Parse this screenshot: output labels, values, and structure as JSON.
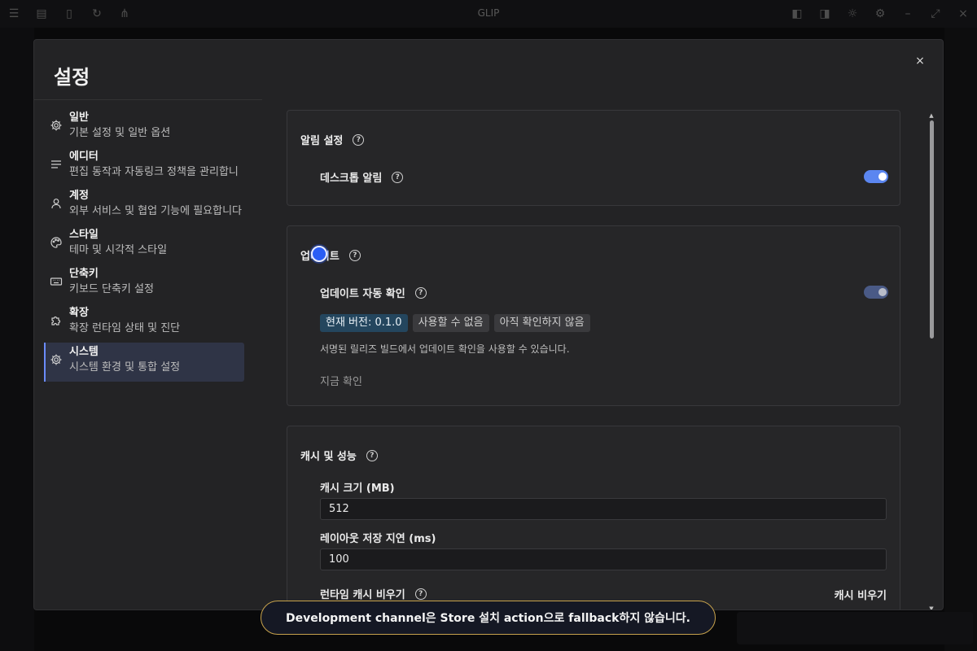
{
  "app": {
    "title": "GLIP"
  },
  "modal": {
    "title": "설정",
    "close": "×"
  },
  "nav": [
    {
      "label": "일반",
      "desc": "기본 설정 및 일반 옵션",
      "icon": "gear-icon"
    },
    {
      "label": "에디터",
      "desc": "편집 동작과 자동링크 정책을 관리합니",
      "icon": "lines-icon"
    },
    {
      "label": "계정",
      "desc": "외부 서비스 및 협업 기능에 필요합니다",
      "icon": "user-icon"
    },
    {
      "label": "스타일",
      "desc": "테마 및 시각적 스타일",
      "icon": "palette-icon"
    },
    {
      "label": "단축키",
      "desc": "키보드 단축키 설정",
      "icon": "keyboard-icon"
    },
    {
      "label": "확장",
      "desc": "확장 런타임 상태 및 진단",
      "icon": "puzzle-icon"
    },
    {
      "label": "시스템",
      "desc": "시스템 환경 및 통합 설정",
      "icon": "system-gear-icon"
    }
  ],
  "notifications": {
    "title": "알림 설정",
    "desktop_label": "데스크톱 알림",
    "desktop_enabled": true
  },
  "updates": {
    "title": "업데이트",
    "auto_check_label": "업데이트 자동 확인",
    "auto_check_enabled": true,
    "version_badge": "현재 버전: 0.1.0",
    "status_badge": "사용할 수 없음",
    "check_badge": "아직 확인하지 않음",
    "hint": "서명된 릴리즈 빌드에서 업데이트 확인을 사용할 수 있습니다.",
    "check_now": "지금 확인"
  },
  "cache": {
    "title": "캐시 및 성능",
    "size_label": "캐시 크기 (MB)",
    "size_value": "512",
    "delay_label": "레이아웃 저장 지연 (ms)",
    "delay_value": "100",
    "runtime_label": "런타임 캐시 비우기",
    "clear_button": "캐시 비우기"
  },
  "toast": {
    "message": "Development channel은 Store 설치 action으로 fallback하지 않습니다."
  },
  "colors": {
    "accent": "#5b86f0",
    "toast_border": "#c7a24c",
    "version_badge": "#24465e"
  }
}
